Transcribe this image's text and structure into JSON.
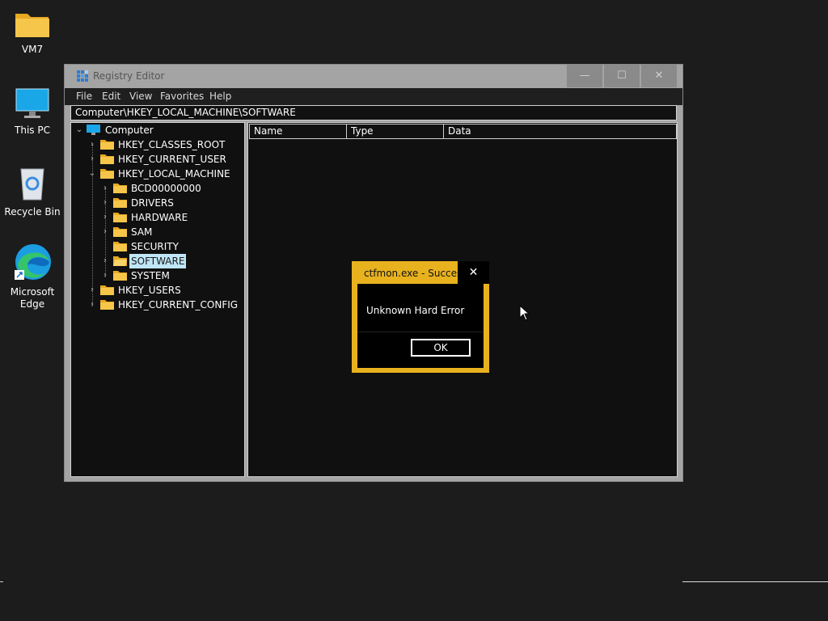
{
  "desktop": {
    "icons": [
      {
        "label": "VM7",
        "icon": "folder-icon"
      },
      {
        "label": "This PC",
        "icon": "monitor-icon"
      },
      {
        "label": "Recycle Bin",
        "icon": "recycle-bin-icon"
      },
      {
        "label": "Microsoft Edge",
        "icon": "edge-icon"
      }
    ]
  },
  "window": {
    "title": "Registry Editor",
    "controls": {
      "minimize": "—",
      "maximize": "☐",
      "close": "✕"
    },
    "menu": [
      "File",
      "Edit",
      "View",
      "Favorites",
      "Help"
    ],
    "address": "Computer\\HKEY_LOCAL_MACHINE\\SOFTWARE",
    "tree": {
      "root": "Computer",
      "hives": [
        "HKEY_CLASSES_ROOT",
        "HKEY_CURRENT_USER",
        "HKEY_LOCAL_MACHINE",
        "HKEY_USERS",
        "HKEY_CURRENT_CONFIG"
      ],
      "hklm_children": [
        "BCD00000000",
        "DRIVERS",
        "HARDWARE",
        "SAM",
        "SECURITY",
        "SOFTWARE",
        "SYSTEM"
      ],
      "selected": "SOFTWARE"
    },
    "columns": [
      "Name",
      "Type",
      "Data"
    ]
  },
  "dialog": {
    "title": "ctfmon.exe - Success",
    "close": "✕",
    "message": "Unknown Hard Error",
    "ok_label": "OK",
    "accent": "#e8b21f"
  }
}
